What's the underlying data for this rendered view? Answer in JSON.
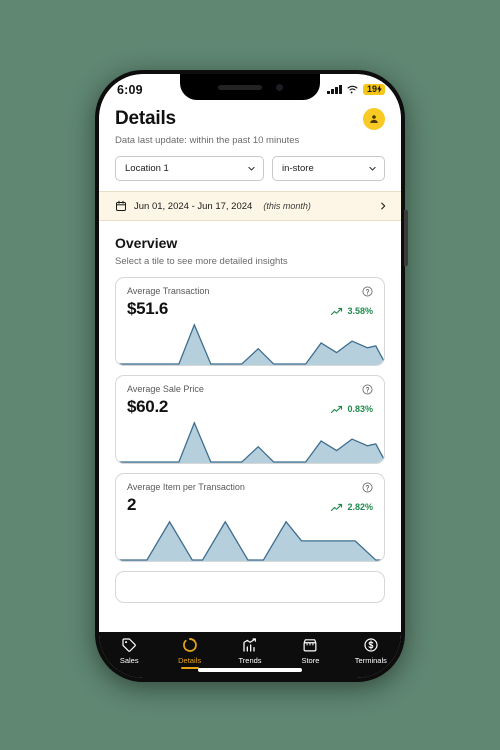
{
  "status_bar": {
    "time": "6:09",
    "battery": "19",
    "battery_charging": true,
    "wifi_icon": "wifi-icon",
    "cellular_icon": "cellular-bars-icon"
  },
  "header": {
    "title": "Details",
    "subtitle": "Data last update: within the past 10 minutes",
    "avatar_icon": "user-avatar-icon",
    "avatar_color": "#f9ca24"
  },
  "filters": {
    "location": {
      "value": "Location 1",
      "chevron_icon": "chevron-down-icon"
    },
    "channel": {
      "value": "in-store",
      "chevron_icon": "chevron-down-icon"
    }
  },
  "date_bar": {
    "calendar_icon": "calendar-icon",
    "range": "Jun 01, 2024 - Jun 17, 2024",
    "scope": "(this month)",
    "chevron_icon": "chevron-right-icon",
    "background": "#fdf6e6"
  },
  "overview": {
    "title": "Overview",
    "subtitle": "Select a tile to see more detailed insights"
  },
  "cards": [
    {
      "label": "Average Transaction",
      "value": "$51.6",
      "delta": "3.58%",
      "delta_color": "#1f8a4c",
      "trend_icon": "trend-up-icon",
      "help_icon": "help-circle-icon"
    },
    {
      "label": "Average Sale Price",
      "value": "$60.2",
      "delta": "0.83%",
      "delta_color": "#1f8a4c",
      "trend_icon": "trend-up-icon",
      "help_icon": "help-circle-icon"
    },
    {
      "label": "Average Item per Transaction",
      "value": "2",
      "delta": "2.82%",
      "delta_color": "#1f8a4c",
      "trend_icon": "trend-up-icon",
      "help_icon": "help-circle-icon"
    }
  ],
  "chart_data": [
    {
      "type": "area",
      "title": "Average Transaction",
      "x": [
        0,
        1,
        2,
        3,
        4,
        5,
        6,
        7,
        8,
        9,
        10,
        11,
        12,
        13,
        14,
        15,
        16
      ],
      "values": [
        0,
        0,
        0,
        0,
        100,
        0,
        0,
        38,
        0,
        0,
        0,
        52,
        24,
        54,
        30,
        34,
        8
      ],
      "ylim": [
        0,
        100
      ],
      "grid": false,
      "legend": "none",
      "line_color": "#3d6e8f",
      "fill_color": "#b6cfdd"
    },
    {
      "type": "area",
      "title": "Average Sale Price",
      "x": [
        0,
        1,
        2,
        3,
        4,
        5,
        6,
        7,
        8,
        9,
        10,
        11,
        12,
        13,
        14,
        15,
        16
      ],
      "values": [
        0,
        0,
        0,
        0,
        100,
        0,
        0,
        38,
        0,
        0,
        0,
        52,
        24,
        54,
        30,
        34,
        8
      ],
      "ylim": [
        0,
        100
      ],
      "grid": false,
      "legend": "none",
      "line_color": "#3d6e8f",
      "fill_color": "#b6cfdd"
    },
    {
      "type": "area",
      "title": "Average Item per Transaction",
      "x": [
        0,
        1,
        2,
        3,
        4,
        5,
        6,
        7,
        8,
        9,
        10,
        11,
        12,
        13,
        14,
        15,
        16
      ],
      "values": [
        0,
        0,
        0,
        0,
        100,
        0,
        100,
        0,
        0,
        0,
        100,
        56,
        56,
        56,
        56,
        0,
        0
      ],
      "ylim": [
        0,
        100
      ],
      "grid": false,
      "legend": "none",
      "line_color": "#3d6e8f",
      "fill_color": "#b6cfdd"
    }
  ],
  "tabs": [
    {
      "label": "Sales",
      "icon": "tag-icon",
      "active": false
    },
    {
      "label": "Details",
      "icon": "donut-chart-icon",
      "active": true
    },
    {
      "label": "Trends",
      "icon": "bar-chart-icon",
      "active": false
    },
    {
      "label": "Store",
      "icon": "storefront-icon",
      "active": false
    },
    {
      "label": "Terminals",
      "icon": "dollar-circle-icon",
      "active": false
    }
  ],
  "accent_color": "#e8a317"
}
